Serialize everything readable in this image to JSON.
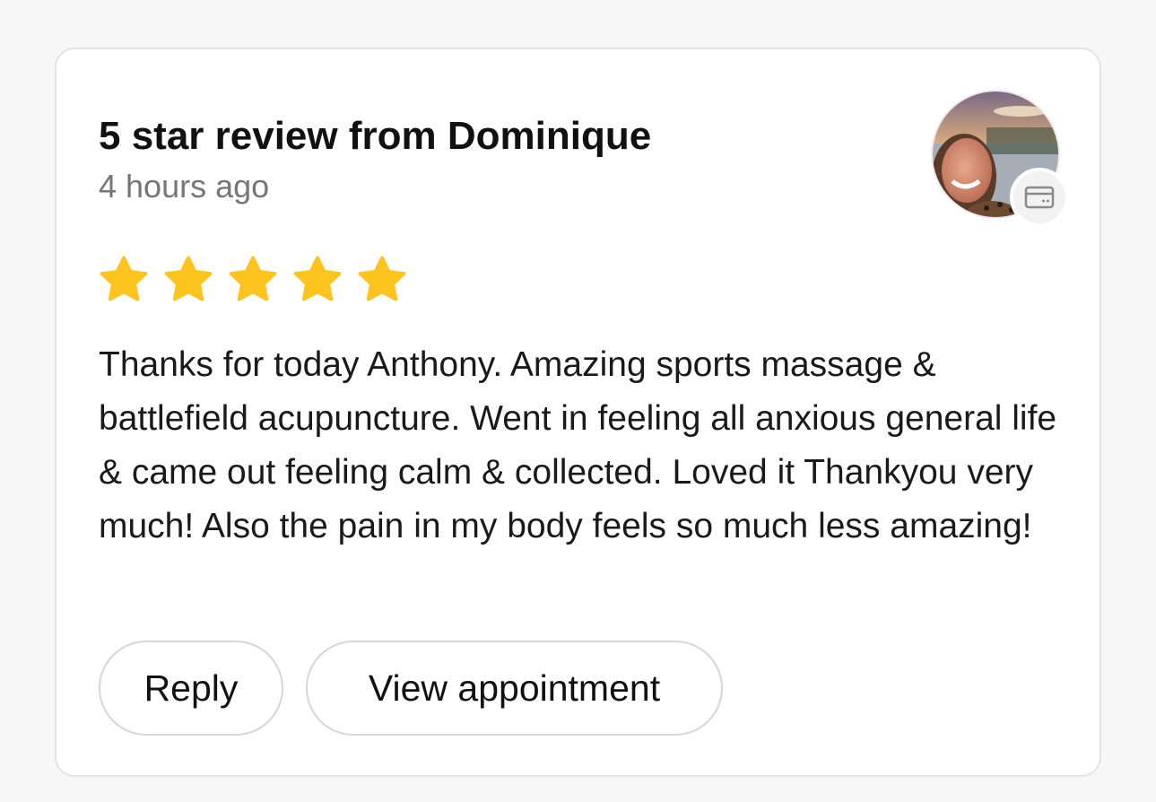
{
  "review": {
    "title": "5 star review from Dominique",
    "time": "4 hours ago",
    "rating": 5,
    "max_rating": 5,
    "star_color": "#FDC41F",
    "text": "Thanks for today Anthony. Amazing sports massage & battlefield acupuncture. Went in feeling all anxious general life & came out feeling calm & collected. Loved it Thankyou very much! Also the pain in my body feels so much less amazing!"
  },
  "avatar": {
    "badge_icon": "card-icon"
  },
  "actions": {
    "reply_label": "Reply",
    "view_label": "View appointment"
  }
}
